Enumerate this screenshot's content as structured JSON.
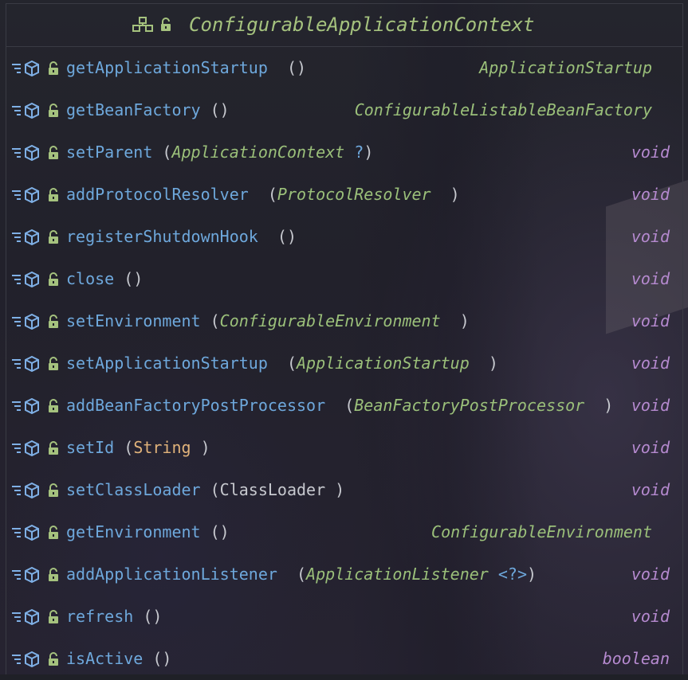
{
  "class_name": "ConfigurableApplicationContext",
  "colors": {
    "method": "#6ea8dc",
    "type_italic": "#9bc07a",
    "keyword": "#b68ad0",
    "string_type": "#e0b27a",
    "lock": "#a5c27e",
    "member_icon": "#7fb0e6"
  },
  "methods": [
    {
      "name": "getApplicationStartup",
      "pre": "  (",
      "param": "",
      "post": ")",
      "ret": "ApplicationStartup"
    },
    {
      "name": "getBeanFactory",
      "pre": " (",
      "param": "",
      "post": ")",
      "ret": "ConfigurableListableBeanFactory"
    },
    {
      "name": "setParent",
      "pre": " (",
      "param": "ApplicationContext",
      "post": " ",
      "post2": "?)",
      "ret": "void"
    },
    {
      "name": "addProtocolResolver",
      "pre": "  (",
      "param": "ProtocolResolver",
      "post": "  )",
      "ret": "void"
    },
    {
      "name": "registerShutdownHook",
      "pre": "  (",
      "param": "",
      "post": ")",
      "ret": "void"
    },
    {
      "name": "close",
      "pre": " (",
      "param": "",
      "post": ")",
      "ret": "void"
    },
    {
      "name": "setEnvironment",
      "pre": " (",
      "param": "ConfigurableEnvironment",
      "post": "  )",
      "ret": "void"
    },
    {
      "name": "setApplicationStartup",
      "pre": "  (",
      "param": "ApplicationStartup",
      "post": "  )",
      "ret": "void"
    },
    {
      "name": "addBeanFactoryPostProcessor",
      "pre": "  (",
      "param": "BeanFactoryPostProcessor",
      "post": "  )",
      "ret": "void"
    },
    {
      "name": "setId",
      "pre": " (",
      "param_plain": "String",
      "post": " )",
      "ret": "void"
    },
    {
      "name": "setClassLoader",
      "pre": " (",
      "param_normal": "ClassLoader",
      "post": " )",
      "ret": "void"
    },
    {
      "name": "getEnvironment",
      "pre": " (",
      "param": "",
      "post": ")",
      "ret": "ConfigurableEnvironment"
    },
    {
      "name": "addApplicationListener",
      "pre": "  (",
      "param": "ApplicationListener",
      "post": " ",
      "generic": "<?>",
      "post2": ")",
      "ret": "void"
    },
    {
      "name": "refresh",
      "pre": " (",
      "param": "",
      "post": ")",
      "ret": "void"
    },
    {
      "name": "isActive",
      "pre": " (",
      "param": "",
      "post": ")",
      "ret": "boolean"
    }
  ],
  "icons": {
    "header": [
      "structure-icon",
      "lock-open-icon"
    ],
    "row": [
      "method-list-icon",
      "cube-icon",
      "lock-open-icon"
    ]
  }
}
